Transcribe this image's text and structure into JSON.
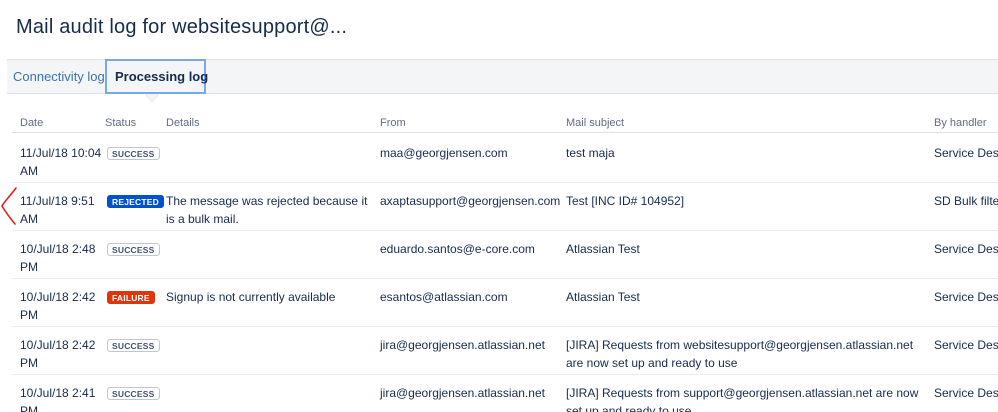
{
  "page_title": "Mail audit log for websitesupport@...",
  "tabs": [
    {
      "label": "Connectivity log"
    },
    {
      "label": "Processing log"
    }
  ],
  "columns": {
    "date": "Date",
    "status": "Status",
    "details": "Details",
    "from": "From",
    "subject": "Mail subject",
    "handler": "By handler"
  },
  "rows": [
    {
      "date": "11/Jul/18 10:04 AM",
      "status": "SUCCESS",
      "details": "",
      "from": "maa@georgjensen.com",
      "subject": "test maja",
      "handler": "Service Desk Handler"
    },
    {
      "date": "11/Jul/18 9:51 AM",
      "status": "REJECTED",
      "details": "The message was rejected because it is a bulk mail.",
      "from": "axaptasupport@georgjensen.com",
      "subject": "Test [INC ID# 104952]",
      "handler": "SD Bulk filte"
    },
    {
      "date": "10/Jul/18 2:48 PM",
      "status": "SUCCESS",
      "details": "",
      "from": "eduardo.santos@e-core.com",
      "subject": "Atlassian Test",
      "handler": "Service Desk Handler"
    },
    {
      "date": "10/Jul/18 2:42 PM",
      "status": "FAILURE",
      "details": "Signup is not currently available",
      "from": "esantos@atlassian.com",
      "subject": "Atlassian Test",
      "handler": "Service Desk Handler"
    },
    {
      "date": "10/Jul/18 2:42 PM",
      "status": "SUCCESS",
      "details": "",
      "from": "jira@georgjensen.atlassian.net",
      "subject": "[JIRA] Requests from websitesupport@georgjensen.atlassian.net are now set up and ready to use",
      "handler": "Service Desk Handler"
    },
    {
      "date": "10/Jul/18 2:41 PM",
      "status": "SUCCESS",
      "details": "",
      "from": "jira@georgjensen.atlassian.net",
      "subject": "[JIRA] Requests from support@georgjensen.atlassian.net are now set up and ready to use",
      "handler": "Service Desk Handler"
    }
  ],
  "colors": {
    "success_border": "#c1c7d0",
    "rejected_bg": "#0052cc",
    "failure_bg": "#de350b",
    "link": "#3b73af",
    "annotation_mark": "#e02020"
  }
}
